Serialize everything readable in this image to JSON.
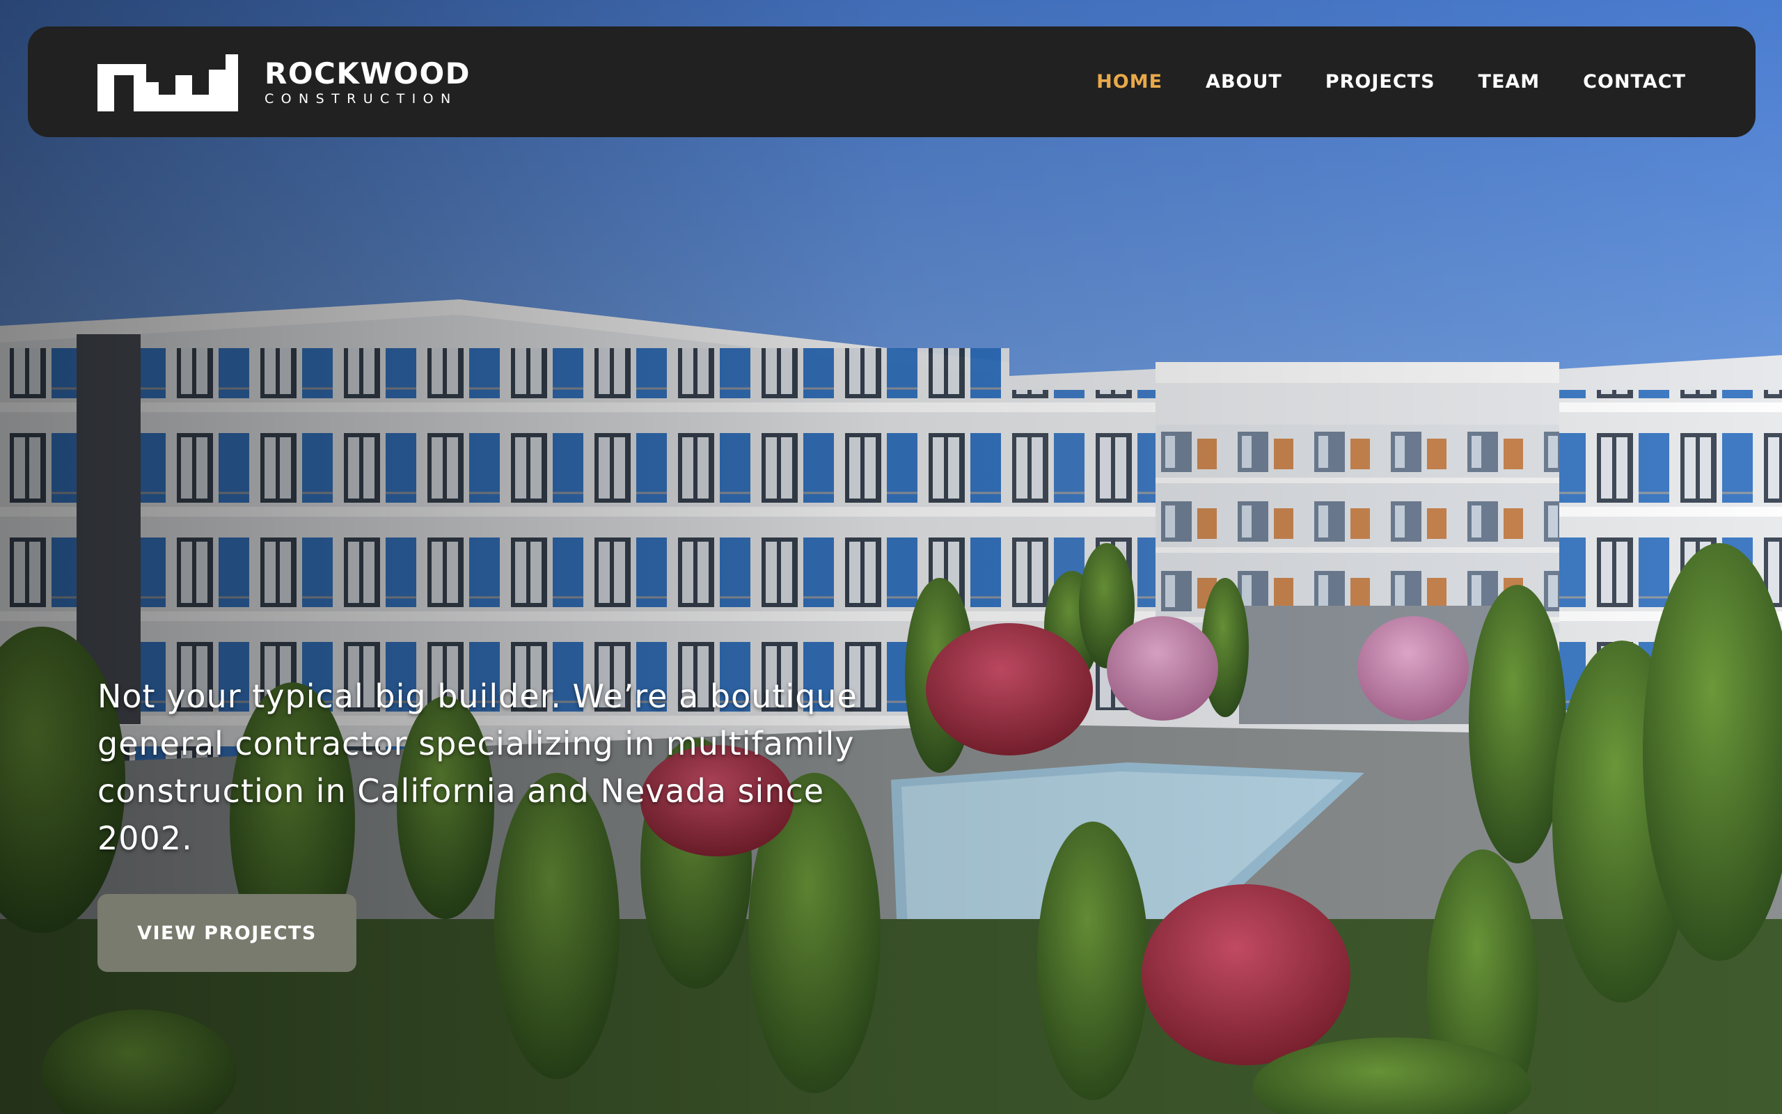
{
  "brand": {
    "name": "ROCKWOOD",
    "subtitle": "CONSTRUCTION",
    "logo_icon": "rw-monogram-icon"
  },
  "nav": {
    "items": [
      {
        "label": "HOME",
        "active": true
      },
      {
        "label": "ABOUT",
        "active": false
      },
      {
        "label": "PROJECTS",
        "active": false
      },
      {
        "label": "TEAM",
        "active": false
      },
      {
        "label": "CONTACT",
        "active": false
      }
    ]
  },
  "hero": {
    "headline": "Not your typical big builder. We’re a boutique general contractor specializing in multifamily construction in California and Nevada since 2002.",
    "cta_label": "VIEW PROJECTS"
  },
  "colors": {
    "navbar_bg": "#212121",
    "nav_active": "#e9a94a",
    "nav_text": "#ffffff",
    "cta_bg": "#787b6d",
    "sky": "#4d7fce",
    "facade_blue": "#2a70c2"
  }
}
